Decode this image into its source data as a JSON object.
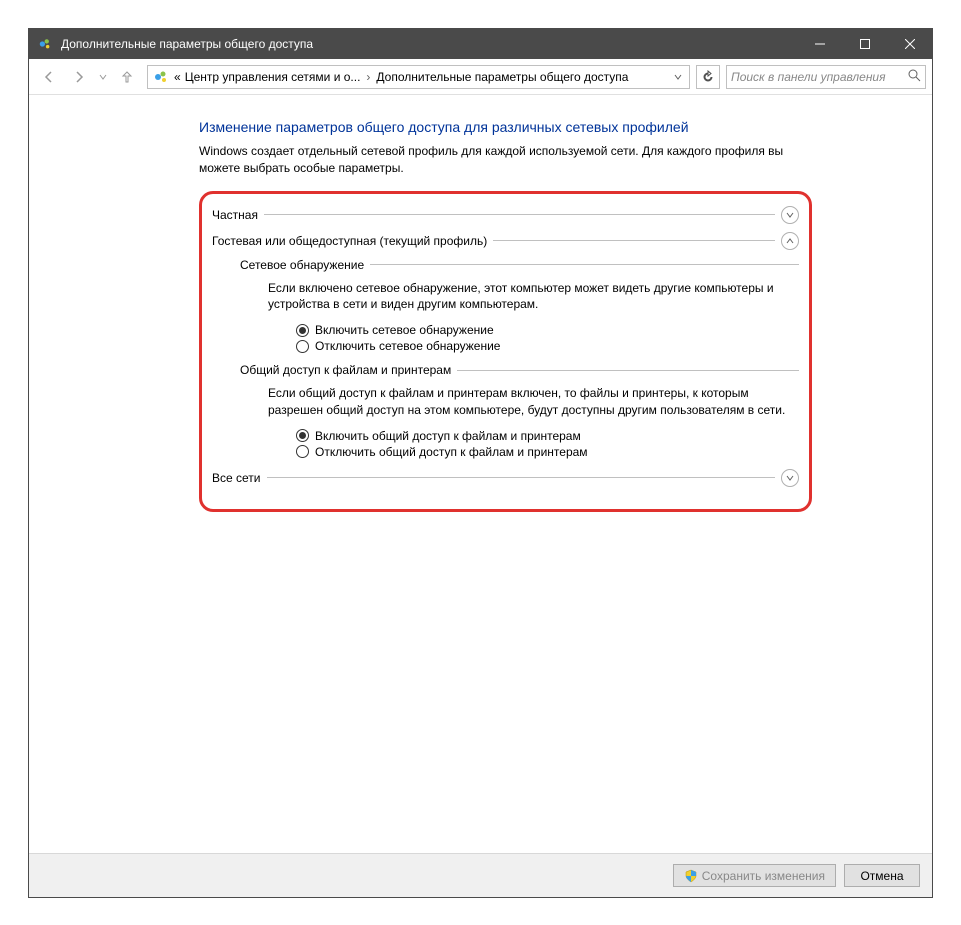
{
  "titlebar": {
    "title": "Дополнительные параметры общего доступа"
  },
  "breadcrumb": {
    "prefix": "«",
    "item1": "Центр управления сетями и о...",
    "item2": "Дополнительные параметры общего доступа"
  },
  "search": {
    "placeholder": "Поиск в панели управления"
  },
  "page": {
    "heading": "Изменение параметров общего доступа для различных сетевых профилей",
    "description": "Windows создает отдельный сетевой профиль для каждой используемой сети. Для каждого профиля вы можете выбрать особые параметры."
  },
  "profiles": {
    "private": {
      "label": "Частная"
    },
    "guest": {
      "label": "Гостевая или общедоступная (текущий профиль)",
      "network_discovery": {
        "title": "Сетевое обнаружение",
        "description": "Если включено сетевое обнаружение, этот компьютер может видеть другие компьютеры и устройства в сети и виден другим компьютерам.",
        "option_on": "Включить сетевое обнаружение",
        "option_off": "Отключить сетевое обнаружение"
      },
      "file_sharing": {
        "title": "Общий доступ к файлам и принтерам",
        "description": "Если общий доступ к файлам и принтерам включен, то файлы и принтеры, к которым разрешен общий доступ на этом компьютере, будут доступны другим пользователям в сети.",
        "option_on": "Включить общий доступ к файлам и принтерам",
        "option_off": "Отключить общий доступ к файлам и принтерам"
      }
    },
    "all": {
      "label": "Все сети"
    }
  },
  "footer": {
    "save": "Сохранить изменения",
    "cancel": "Отмена"
  }
}
